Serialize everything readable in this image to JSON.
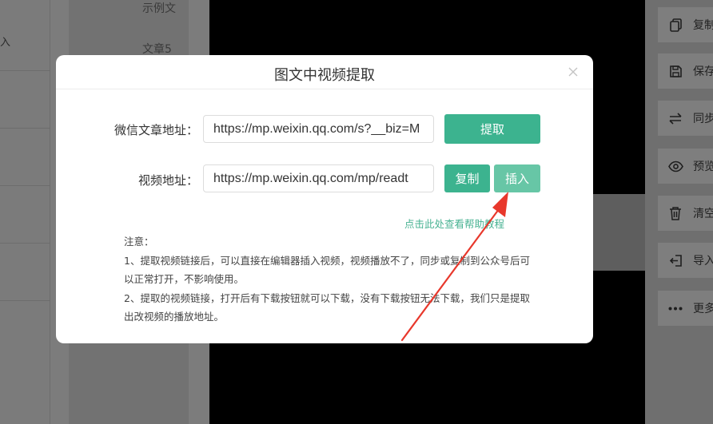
{
  "background": {
    "left_label": "入",
    "list_items": [
      "示例文",
      "文章5"
    ],
    "tools": [
      {
        "icon": "copy-icon",
        "label": "复制"
      },
      {
        "icon": "save-icon",
        "label": "保存"
      },
      {
        "icon": "sync-icon",
        "label": "同步"
      },
      {
        "icon": "eye-icon",
        "label": "预览"
      },
      {
        "icon": "trash-icon",
        "label": "清空"
      },
      {
        "icon": "import-icon",
        "label": "导入"
      },
      {
        "icon": "more-icon",
        "label": "更多"
      }
    ]
  },
  "modal": {
    "title": "图文中视频提取",
    "article_url": {
      "label": "微信文章地址：",
      "value": "https://mp.weixin.qq.com/s?__biz=M"
    },
    "extract_button": "提取",
    "video_url": {
      "label": "视频地址：",
      "value": "https://mp.weixin.qq.com/mp/readt"
    },
    "copy_button": "复制",
    "insert_button": "插入",
    "help_link": "点击此处查看帮助教程",
    "notice": [
      "注意：",
      "1、提取视频链接后，可以直接在编辑器插入视频，视频播放不了，同步或复制到公众号后可以正常打开，不影响使用。",
      "2、提取的视频链接，打开后有下载按钮就可以下载，没有下载按钮无法下载，我们只是提取出改视频的播放地址。"
    ]
  },
  "colors": {
    "primary": "#3cb38f",
    "primary_light": "#67c6a6",
    "link": "#47b292",
    "annotation_arrow": "#e8382c"
  }
}
